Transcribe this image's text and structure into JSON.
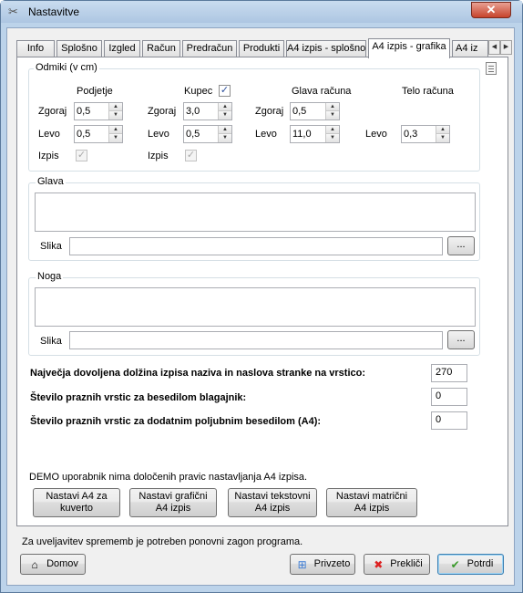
{
  "window": {
    "title": "Nastavitve",
    "close_label": "✕"
  },
  "tabs": [
    {
      "label": "Info"
    },
    {
      "label": "Splošno"
    },
    {
      "label": "Izgled"
    },
    {
      "label": "Račun"
    },
    {
      "label": "Predračun"
    },
    {
      "label": "Produkti"
    },
    {
      "label": "A4 izpis - splošno"
    },
    {
      "label": "A4 izpis - grafika",
      "active": true
    },
    {
      "label": "A4 iz"
    }
  ],
  "odmiki": {
    "group_label": "Odmiki (v cm)",
    "podjetje": {
      "header": "Podjetje",
      "zgoraj_label": "Zgoraj",
      "zgoraj": "0,5",
      "levo_label": "Levo",
      "levo": "0,5",
      "izpis_label": "Izpis",
      "izpis_checked": true
    },
    "kupec": {
      "header": "Kupec",
      "header_checked": true,
      "zgoraj_label": "Zgoraj",
      "zgoraj": "3,0",
      "levo_label": "Levo",
      "levo": "0,5",
      "izpis_label": "Izpis",
      "izpis_checked": true
    },
    "glava": {
      "header": "Glava računa",
      "zgoraj_label": "Zgoraj",
      "zgoraj": "0,5",
      "levo_label": "Levo",
      "levo": "11,0"
    },
    "telo": {
      "header": "Telo računa",
      "levo_label": "Levo",
      "levo": "0,3"
    }
  },
  "glava": {
    "group_label": "Glava",
    "slika_label": "Slika",
    "slika_value": "",
    "browse_label": "..."
  },
  "noga": {
    "group_label": "Noga",
    "slika_label": "Slika",
    "slika_value": "",
    "browse_label": "..."
  },
  "settings": [
    {
      "label": "Največja dovoljena dolžina izpisa naziva in naslova stranke na vrstico:",
      "value": "270"
    },
    {
      "label": "Število praznih vrstic za besedilom blagajnik:",
      "value": "0"
    },
    {
      "label": "Število praznih vrstic za dodatnim poljubnim besedilom (A4):",
      "value": "0"
    }
  ],
  "demo_text": "DEMO uporabnik nima določenih pravic nastavljanja A4 izpisa.",
  "preset_buttons": [
    {
      "line1": "Nastavi A4 za",
      "line2": "kuverto"
    },
    {
      "line1": "Nastavi grafični",
      "line2": "A4 izpis"
    },
    {
      "line1": "Nastavi tekstovni",
      "line2": "A4 izpis"
    },
    {
      "line1": "Nastavi matrični",
      "line2": "A4 izpis"
    }
  ],
  "status_text": "Za uveljavitev sprememb je potreben ponovni zagon programa.",
  "footer": {
    "home_label": "Domov",
    "home_icon": "home-icon",
    "defaults_label": "Privzeto",
    "defaults_icon": "windows-icon",
    "cancel_label": "Prekliči",
    "cancel_icon": "cancel-x-icon",
    "ok_label": "Potrdi",
    "ok_icon": "checkmark-icon"
  }
}
